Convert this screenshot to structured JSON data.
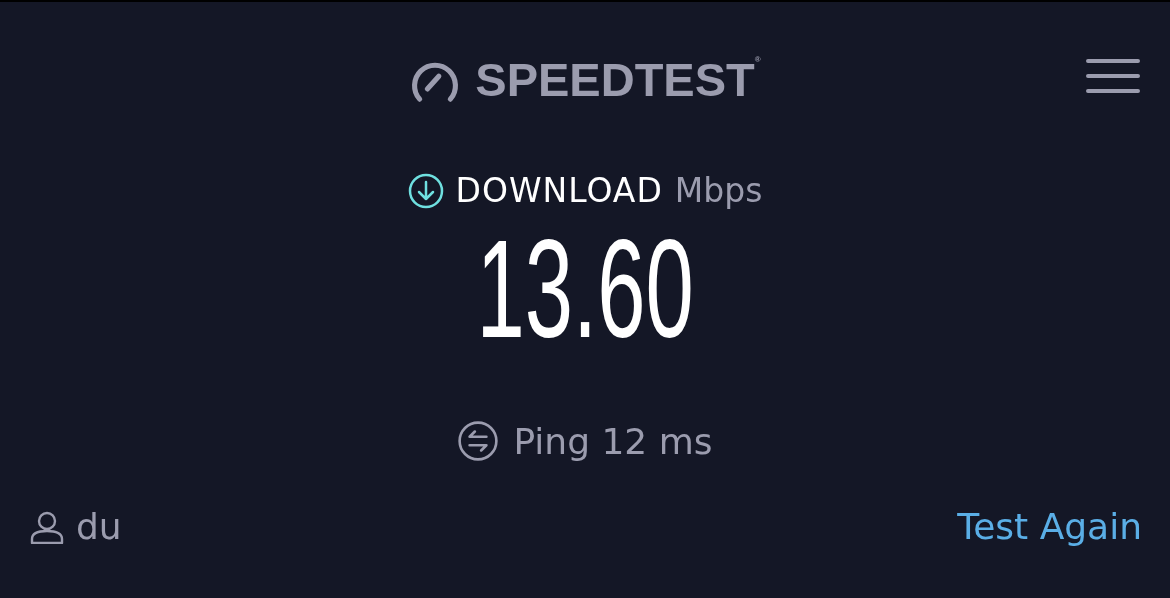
{
  "header": {
    "logo_text": "SPEEDTEST$^{®}$"
  },
  "result": {
    "label": "DOWNLOAD",
    "unit": "Mbps",
    "value": "13.60"
  },
  "ping": {
    "label": "Ping 12 ms"
  },
  "footer": {
    "provider": "du",
    "action": "Test Again"
  }
}
